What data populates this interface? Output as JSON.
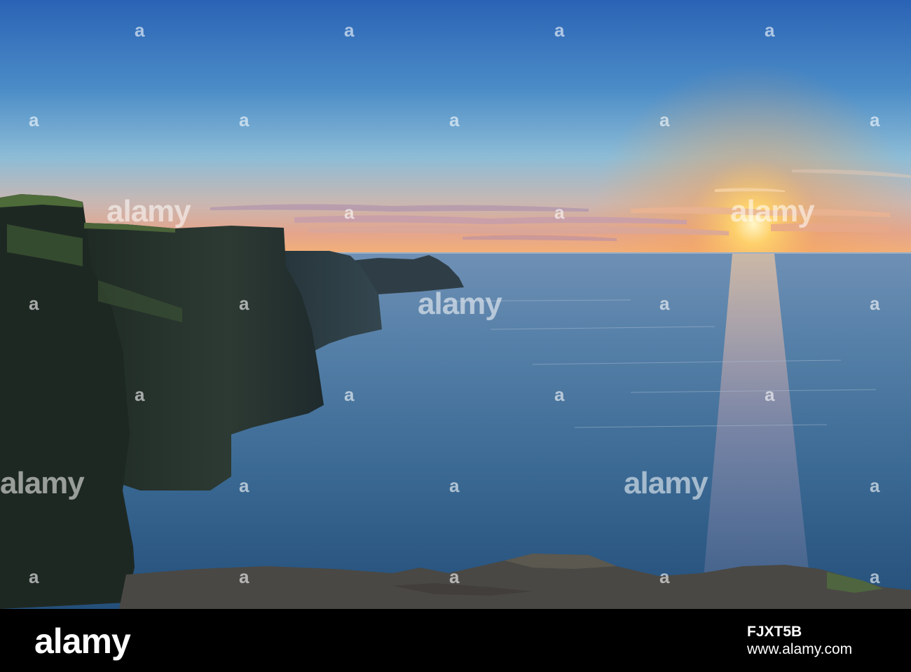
{
  "watermark": {
    "word": "alamy",
    "mark": "a"
  },
  "footer": {
    "brand": "alamy",
    "image_id": "FJXT5B",
    "url": "www.alamy.com"
  }
}
